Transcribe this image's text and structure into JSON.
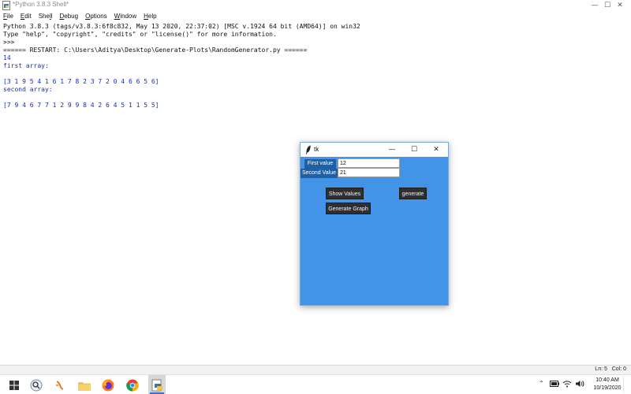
{
  "window": {
    "title": "*Python 3.8.3 Shell*",
    "controls": {
      "minimize": "—",
      "maximize": "☐",
      "close": "✕"
    }
  },
  "menu": {
    "items": [
      {
        "u": "F",
        "rest": "ile"
      },
      {
        "u": "E",
        "rest": "dit"
      },
      {
        "pre": "She",
        "u": "l",
        "rest": "l"
      },
      {
        "u": "D",
        "rest": "ebug"
      },
      {
        "u": "O",
        "rest": "ptions"
      },
      {
        "u": "W",
        "rest": "indow"
      },
      {
        "u": "H",
        "rest": "elp"
      }
    ]
  },
  "shell": {
    "lines": [
      {
        "text": "Python 3.8.3 (tags/v3.8.3:6f8c832, May 13 2020, 22:37:02) [MSC v.1924 64 bit (AMD64)] on win32",
        "color": "black"
      },
      {
        "text": "Type \"help\", \"copyright\", \"credits\" or \"license()\" for more information.",
        "color": "black"
      },
      {
        "text": ">>> ",
        "color": "black"
      },
      {
        "text": "====== RESTART: C:\\Users\\Aditya\\Desktop\\Generate-Plots\\RandomGenerator.py ======",
        "color": "black"
      },
      {
        "text": "14",
        "color": "blue"
      },
      {
        "text": "first array:",
        "color": "blue"
      },
      {
        "text": "",
        "color": "blue"
      },
      {
        "text": "[3 1 9 5 4 1 6 1 7 8 2 3 7 2 0 4 6 6 5 6]",
        "color": "blue"
      },
      {
        "text": "second array:",
        "color": "blue"
      },
      {
        "text": "",
        "color": "blue"
      },
      {
        "text": "[7 9 4 6 7 7 1 2 9 9 8 4 2 6 4 5 1 1 5 5]",
        "color": "blue"
      }
    ]
  },
  "status": {
    "text": "Ln: 5   Col: 0"
  },
  "tk_window": {
    "title": "tk",
    "first_label": "First value",
    "first_value": "12",
    "second_label": "Second Value",
    "second_value": "21",
    "show_values_button": "Show Values",
    "generate_button": "generate",
    "generate_graph_button": "Generate Graph",
    "background_color": "#4194e6"
  },
  "taskbar": {
    "icons": [
      "windows-start-icon",
      "search-icon",
      "task-view-icon",
      "file-explorer-icon",
      "firefox-icon",
      "chrome-icon",
      "python-idle-icon"
    ],
    "tray": [
      "chevron-up-icon",
      "battery-icon",
      "wifi-icon",
      "volume-icon"
    ],
    "time": "10:40 AM",
    "date": "10/19/2020"
  }
}
